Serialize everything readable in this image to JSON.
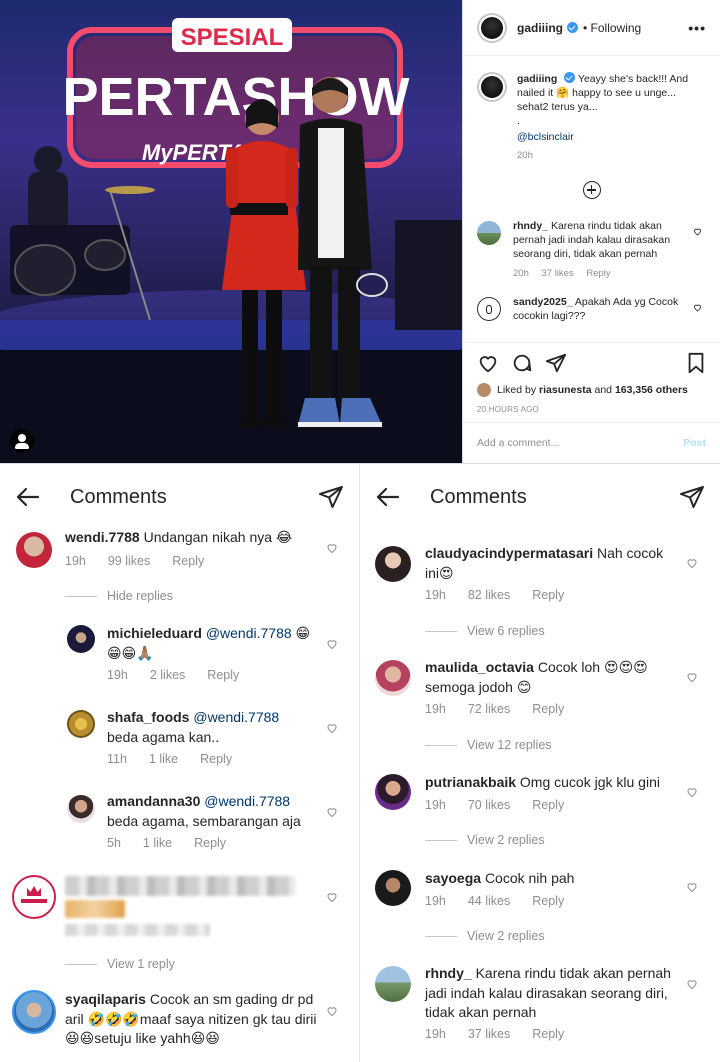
{
  "post": {
    "photo_sign": {
      "top": "SPESIAL",
      "main": "PERTASHOW",
      "sub": "MyPERTA"
    },
    "username": "gadiiing",
    "following_label": "• Following",
    "more_label": "•••",
    "caption": {
      "username": "gadiiing",
      "text": "Yeayy she's back!!! And nailed it 🤗 happy to see u unge... sehat2 terus ya...",
      "dot": ".",
      "mention": "@bclsinclair",
      "time": "20h"
    },
    "comments": [
      {
        "username": "rhndy_",
        "text": "Karena rindu tidak akan pernah jadi indah kalau dirasakan seorang diri, tidak akan pernah",
        "time": "20h",
        "likes": "37 likes",
        "reply": "Reply"
      },
      {
        "username": "sandy2025_",
        "text": "Apakah Ada yg Cocok cocokin lagi???"
      }
    ],
    "liked_by": {
      "prefix": "Liked by",
      "user": "riasunesta",
      "and": "and",
      "others": "163,356 others"
    },
    "date": "20 HOURS AGO",
    "add_comment_placeholder": "Add a comment...",
    "post_label": "Post"
  },
  "left_panel": {
    "title": "Comments",
    "comments": [
      {
        "username": "wendi.7788",
        "text": "Undangan nikah nya 😂",
        "time": "19h",
        "likes": "99 likes",
        "reply": "Reply"
      },
      {
        "replies_label": "Hide replies"
      },
      {
        "username": "michieleduard",
        "mention": "@wendi.7788",
        "text": "😁😁😁🙏🏽",
        "time": "19h",
        "likes": "2 likes",
        "reply": "Reply"
      },
      {
        "username": "shafa_foods",
        "mention": "@wendi.7788",
        "text": "beda agama kan..",
        "time": "11h",
        "likes": "1 like",
        "reply": "Reply"
      },
      {
        "username": "amandanna30",
        "mention": "@wendi.7788",
        "text": "beda agama, sembarangan aja",
        "time": "5h",
        "likes": "1 like",
        "reply": "Reply"
      },
      {
        "replies_label": "View 1 reply"
      },
      {
        "username": "syaqilaparis",
        "text": "Cocok an sm gading dr pd aril 🤣🤣🤣maaf saya nitizen gk tau dirii😆😆setuju like yahh😆😆"
      }
    ]
  },
  "right_panel": {
    "title": "Comments",
    "comments": [
      {
        "username": "claudyacindypermatasari",
        "text": "Nah cocok ini😍",
        "time": "19h",
        "likes": "82 likes",
        "reply": "Reply",
        "replies_label": "View 6 replies"
      },
      {
        "username": "maulida_octavia",
        "text": "Cocok loh 😍😍😍 semoga jodoh 😊",
        "time": "19h",
        "likes": "72 likes",
        "reply": "Reply",
        "replies_label": "View 12 replies"
      },
      {
        "username": "putrianakbaik",
        "text": "Omg cucok jgk klu gini",
        "time": "19h",
        "likes": "70 likes",
        "reply": "Reply",
        "replies_label": "View 2 replies"
      },
      {
        "username": "sayoega",
        "text": "Cocok nih pah",
        "time": "19h",
        "likes": "44 likes",
        "reply": "Reply",
        "replies_label": "View 2 replies"
      },
      {
        "username": "rhndy_",
        "text": "Karena rindu tidak akan pernah jadi indah kalau dirasakan seorang diri, tidak akan pernah",
        "time": "19h",
        "likes": "37 likes",
        "reply": "Reply"
      }
    ]
  },
  "colors": {
    "link": "#00376b",
    "muted": "#8e8e8e",
    "verified": "#3897f0",
    "post_btn": "#b2dffc"
  }
}
